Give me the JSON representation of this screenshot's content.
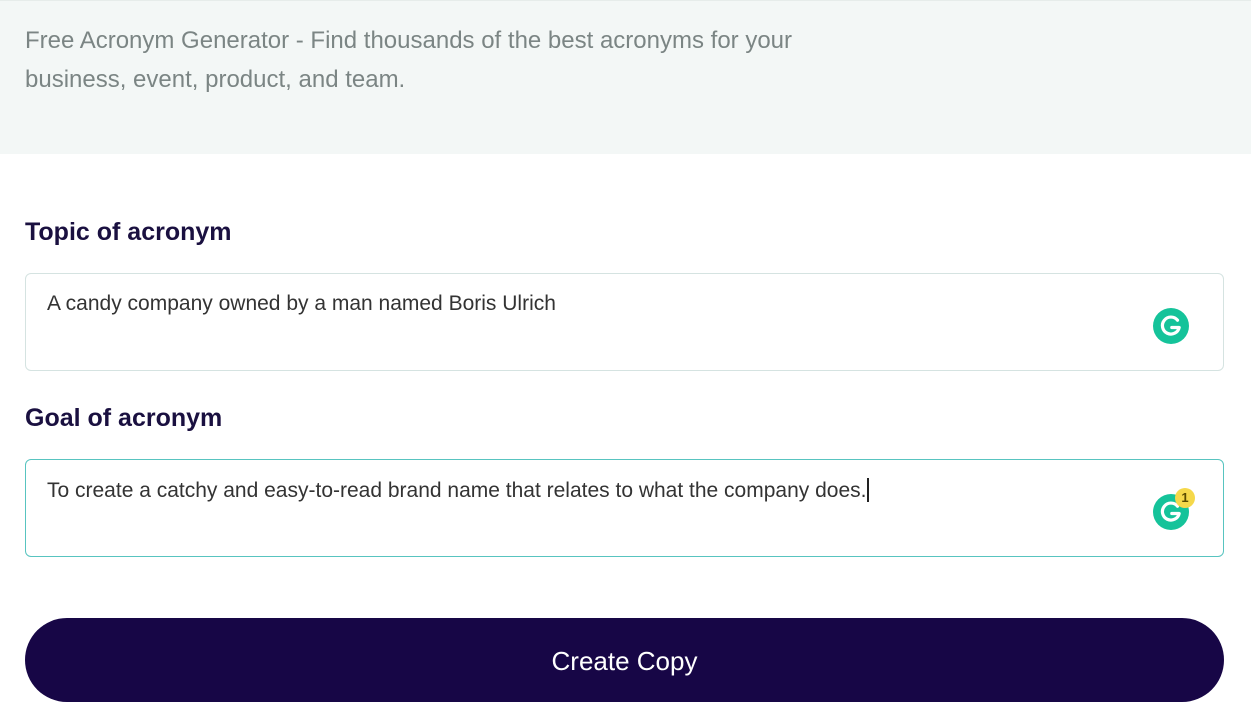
{
  "header": {
    "description": "Free Acronym Generator - Find thousands of the best acronyms for your business, event, product, and team."
  },
  "form": {
    "topic": {
      "label": "Topic of acronym",
      "value": "A candy company owned by a man named Boris Ulrich"
    },
    "goal": {
      "label": "Goal of acronym",
      "value": "To create a catchy and easy-to-read brand name that relates to what the company does."
    },
    "grammarly_badge_count": "1",
    "submit_label": "Create Copy"
  },
  "colors": {
    "button_bg": "#170646",
    "grammarly": "#15c39a",
    "badge": "#f5d84a",
    "focus_border": "#58c4c0"
  },
  "icons": {
    "grammarly": "grammarly-icon"
  }
}
